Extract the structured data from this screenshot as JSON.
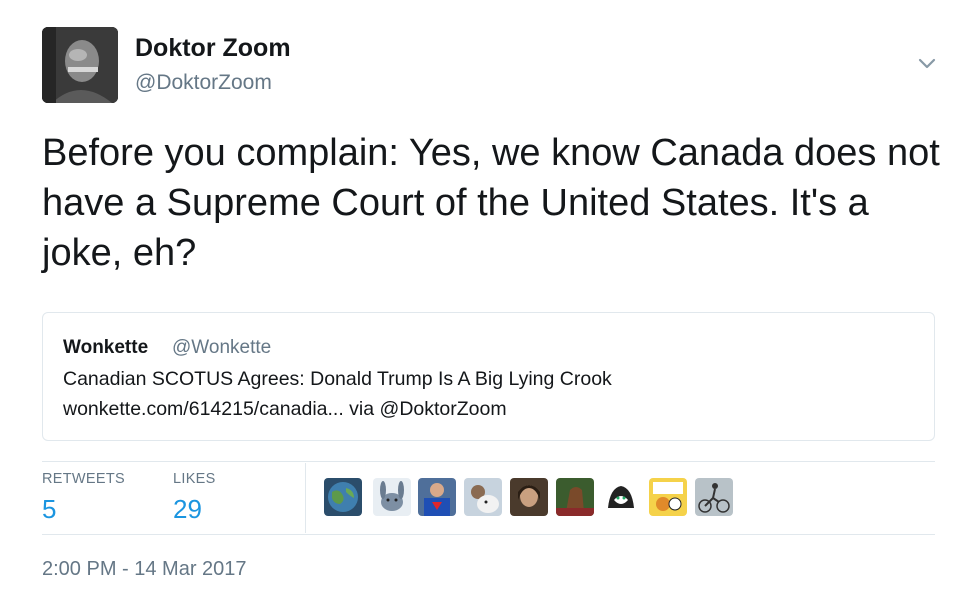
{
  "author": {
    "display_name": "Doktor Zoom",
    "handle": "@DoktorZoom"
  },
  "tweet": {
    "text": "Before you complain: Yes, we know Canada does not have a Supreme Court of the United States. It's a joke, eh?",
    "timestamp": "2:00 PM - 14 Mar 2017"
  },
  "quote": {
    "name": "Wonkette",
    "handle": "@Wonkette",
    "headline": "Canadian SCOTUS Agrees: Donald Trump Is A Big Lying Crook",
    "link_line": "wonkette.com/614215/canadia... via @DoktorZoom"
  },
  "stats": {
    "retweets_label": "RETWEETS",
    "retweets_value": "5",
    "likes_label": "LIKES",
    "likes_value": "29"
  },
  "likers": [
    {
      "icon": "earth-avatar"
    },
    {
      "icon": "eeyore-avatar"
    },
    {
      "icon": "superman-avatar"
    },
    {
      "icon": "dog-avatar"
    },
    {
      "icon": "woman-avatar"
    },
    {
      "icon": "horse-avatar"
    },
    {
      "icon": "cat-avatar"
    },
    {
      "icon": "cartoon-avatar"
    },
    {
      "icon": "cyclist-avatar"
    }
  ],
  "colors": {
    "link_blue": "#1b95e0",
    "secondary_gray": "#657786",
    "border": "#e1e8ed"
  },
  "icons": {
    "caret": "chevron-down-icon"
  }
}
